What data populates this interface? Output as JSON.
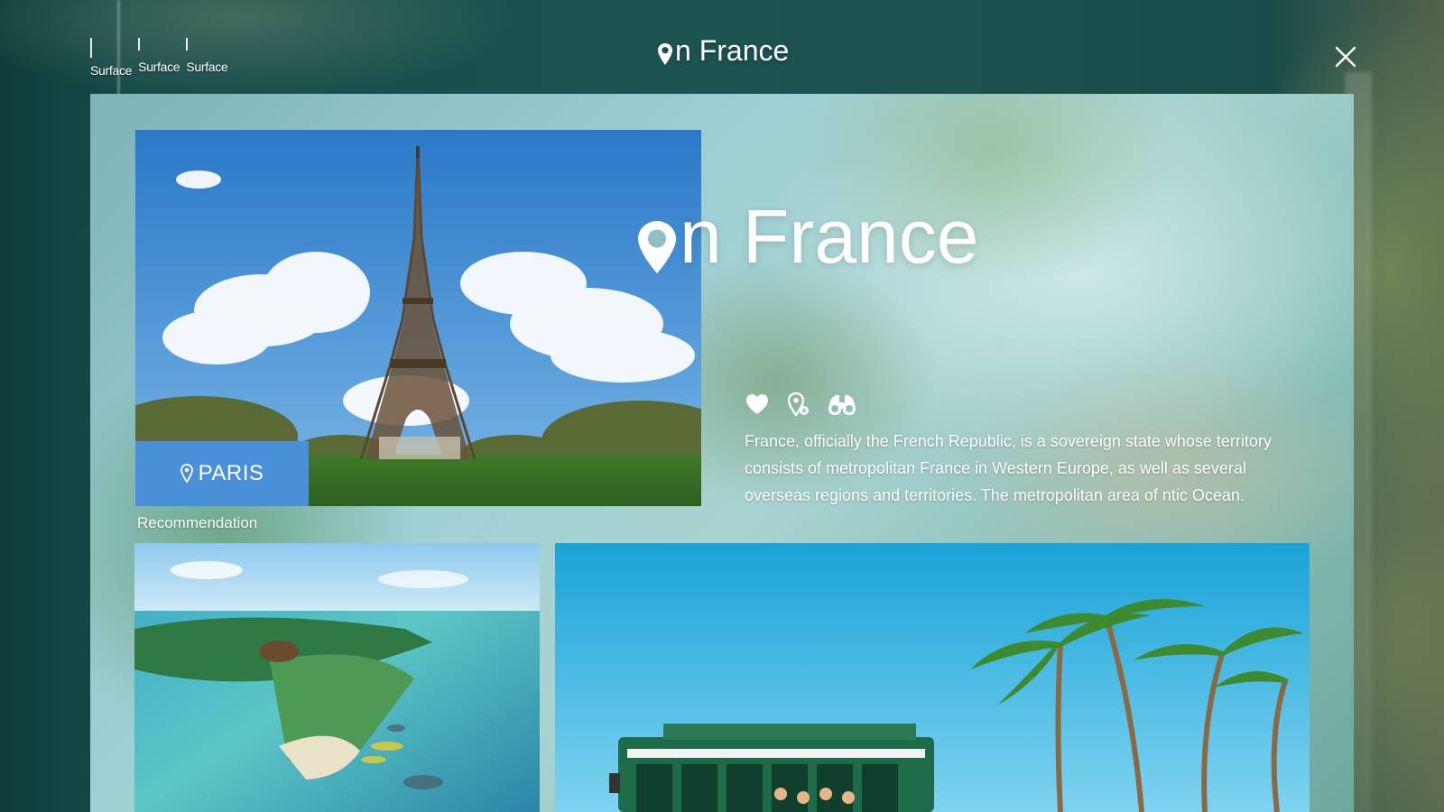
{
  "header": {
    "surface_tabs": [
      {
        "label": "Surface"
      },
      {
        "label": "Surface"
      },
      {
        "label": "Surface"
      }
    ],
    "title_text": "n France",
    "icons": {
      "title": "location-pin-icon",
      "close": "close-icon"
    }
  },
  "hero": {
    "image": "eiffel-tower-photo",
    "city_label": "PARIS",
    "city_icon": "location-pin-icon"
  },
  "destination": {
    "title_text": "n France",
    "actions": [
      {
        "icon": "heart-icon"
      },
      {
        "icon": "add-location-icon"
      },
      {
        "icon": "binoculars-icon"
      }
    ],
    "description": "France, officially the French Republic, is a sovereign state whose territory consists of metropolitan France in Western Europe, as well as several overseas regions and territories. The metropolitan area of ntic Ocean."
  },
  "recommendation": {
    "label": "Recommendation",
    "cards": [
      {
        "image": "tropical-island-aerial-photo"
      },
      {
        "image": "beach-trolley-palm-trees-photo"
      }
    ]
  },
  "colors": {
    "accent": "#4a90d9",
    "text": "#ffffff"
  }
}
